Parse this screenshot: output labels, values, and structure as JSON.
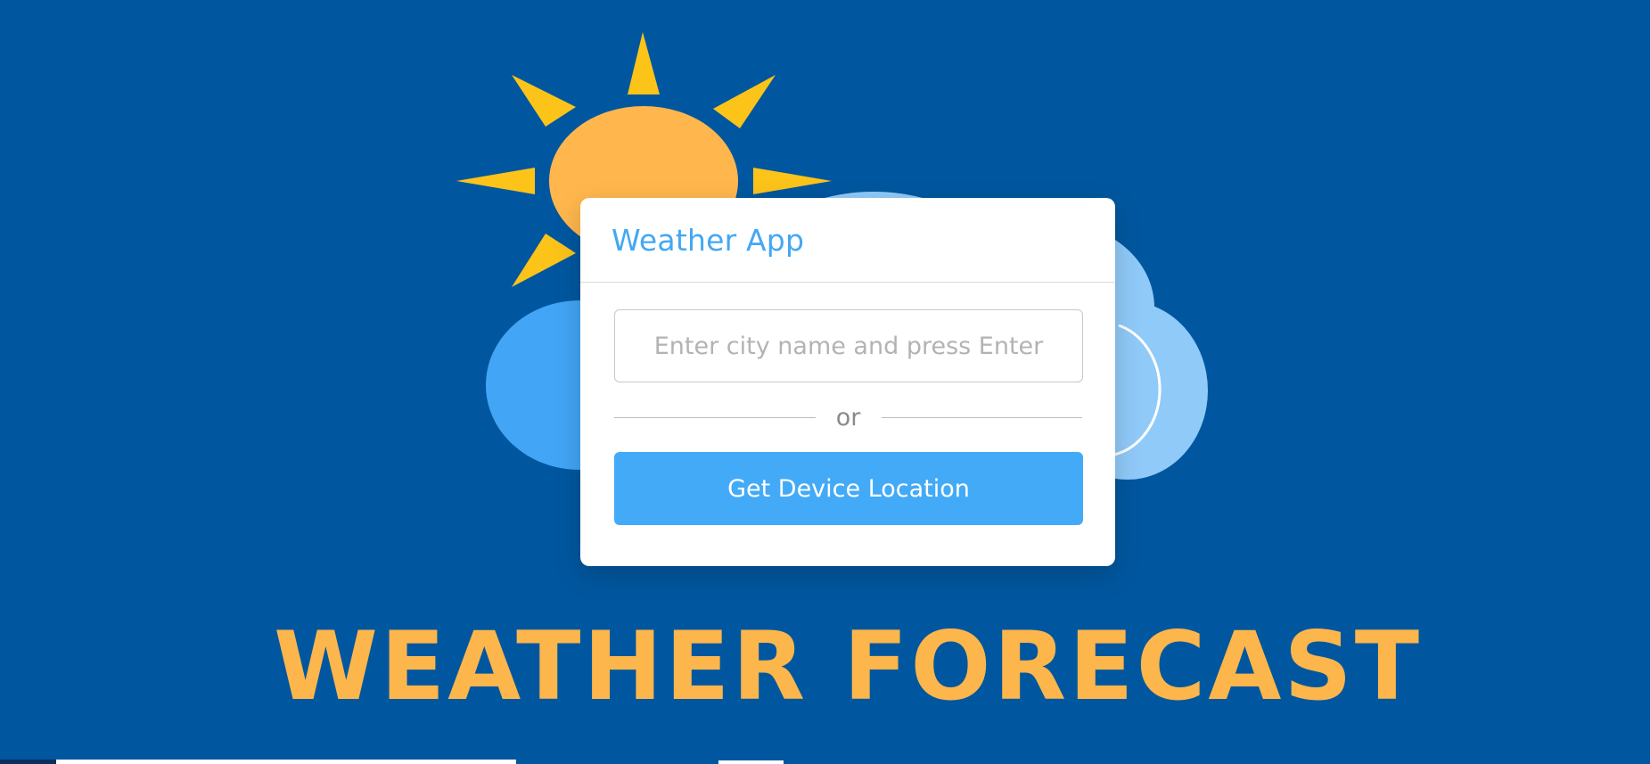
{
  "colors": {
    "background": "#01579f",
    "sun": "#ffb74d",
    "sun_rays": "#fcc419",
    "cloud_front": "#42a5f5",
    "cloud_back": "#90caf9",
    "accent": "#43a8f3",
    "banner": "#fdb64b"
  },
  "illustration": {
    "sun_icon": "sun-icon",
    "cloud_icon": "cloud-icon"
  },
  "card": {
    "title": "Weather App",
    "city_input": {
      "value": "",
      "placeholder": "Enter city name and press Enter"
    },
    "divider_text": "or",
    "location_button_label": "Get Device Location"
  },
  "banner": {
    "text": "WEATHER FORECAST"
  }
}
